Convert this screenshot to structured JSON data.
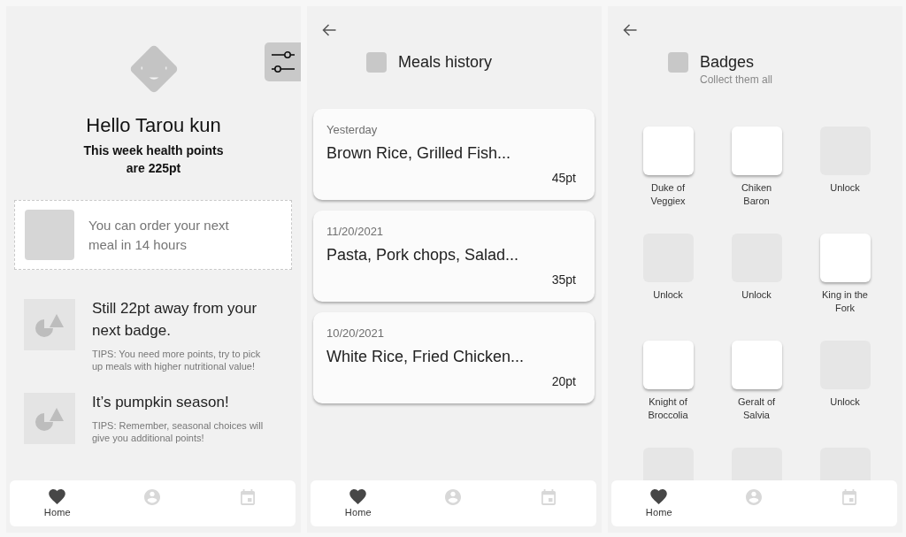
{
  "home_screen": {
    "greeting": "Hello Tarou kun",
    "points_summary": "This week health points are 225pt",
    "order_notice": "You can order your next meal in 14 hours",
    "tips": [
      {
        "title": "Still 22pt away from your next badge.",
        "text": "TIPS: You need more points, try to pick up meals with higher nutritional value!"
      },
      {
        "title": "It’s pumpkin season!",
        "text": "TIPS: Remember, seasonal choices will give you additional points!"
      }
    ],
    "nav_bar": [
      {
        "label": "Home",
        "selected": true
      },
      {
        "selected": false
      },
      {
        "selected": false
      }
    ]
  },
  "meals_history_screen": {
    "title": "Meals history",
    "meals": [
      {
        "date": "Yesterday",
        "items": "Brown Rice, Grilled Fish...",
        "points": "45pt"
      },
      {
        "date": "11/20/2021",
        "items": "Pasta, Pork chops, Salad...",
        "points": "35pt"
      },
      {
        "date": "10/20/2021",
        "items": "White Rice, Fried Chicken...",
        "points": "20pt"
      }
    ],
    "nav_bar": [
      {
        "label": "Home",
        "selected": true
      },
      {
        "selected": false
      },
      {
        "selected": false
      }
    ]
  },
  "badges_screen": {
    "title": "Badges",
    "subtitle": "Collect them all",
    "badges": [
      {
        "label": "Duke of Veggiex",
        "unlocked": true
      },
      {
        "label": "Chiken Baron",
        "unlocked": true
      },
      {
        "label": "Unlock",
        "unlocked": false
      },
      {
        "label": "Unlock",
        "unlocked": false
      },
      {
        "label": "Unlock",
        "unlocked": false
      },
      {
        "label": "King in the Fork",
        "unlocked": true
      },
      {
        "label": "Knight of Broccolia",
        "unlocked": true
      },
      {
        "label": "Geralt of Salvia",
        "unlocked": true
      },
      {
        "label": "Unlock",
        "unlocked": false
      },
      {
        "unlocked": false
      },
      {
        "unlocked": false
      },
      {
        "unlocked": false
      }
    ],
    "nav_bar": [
      {
        "label": "Home",
        "selected": true
      },
      {
        "selected": false
      },
      {
        "selected": false
      }
    ]
  }
}
